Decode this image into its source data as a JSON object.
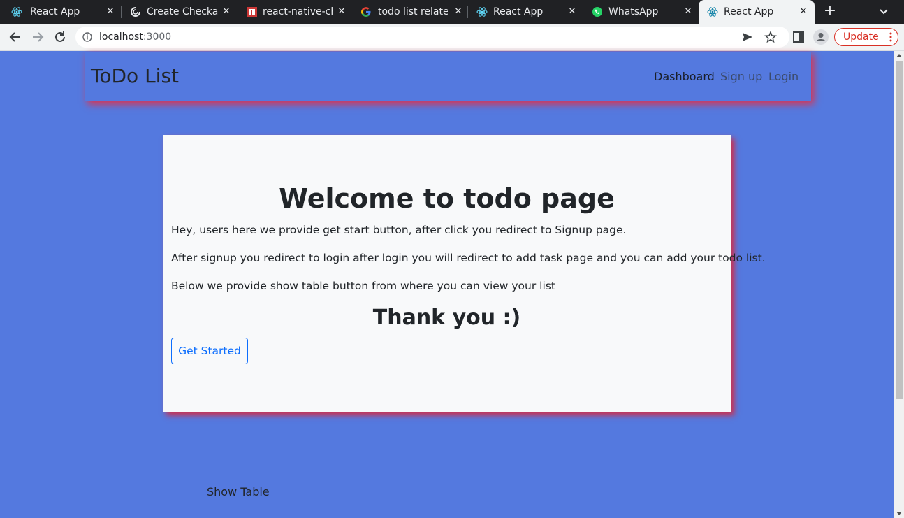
{
  "browser": {
    "tabs": [
      {
        "title": "React App",
        "icon": "react-icon"
      },
      {
        "title": "Create Checkat",
        "icon": "codepen-icon"
      },
      {
        "title": "react-native-ch",
        "icon": "npm-icon"
      },
      {
        "title": "todo list relate",
        "icon": "google-icon"
      },
      {
        "title": "React App",
        "icon": "react-icon"
      },
      {
        "title": "WhatsApp",
        "icon": "whatsapp-icon"
      },
      {
        "title": "React App",
        "icon": "react-icon",
        "active": true
      }
    ],
    "url_host": "localhost",
    "url_port": ":3000",
    "update_label": "Update",
    "update_color": "#d93025"
  },
  "navbar": {
    "brand": "ToDo List",
    "links": [
      "Dashboard",
      "Sign up",
      "Login"
    ]
  },
  "card": {
    "heading": "Welcome to todo page",
    "paragraphs": [
      "Hey, users here we provide get start button, after click you redirect to Signup page.",
      "After signup you redirect to login after login you will redirect to add task page and you can add your todo list.",
      "Below we provide show table button from where you can view your list"
    ],
    "thanks": "Thank you :)",
    "button_label": "Get Started"
  },
  "show_table_label": "Show Table",
  "colors": {
    "page_bg": "#5479df",
    "shadow": "#e0304a",
    "button_blue": "#0d6efd"
  }
}
